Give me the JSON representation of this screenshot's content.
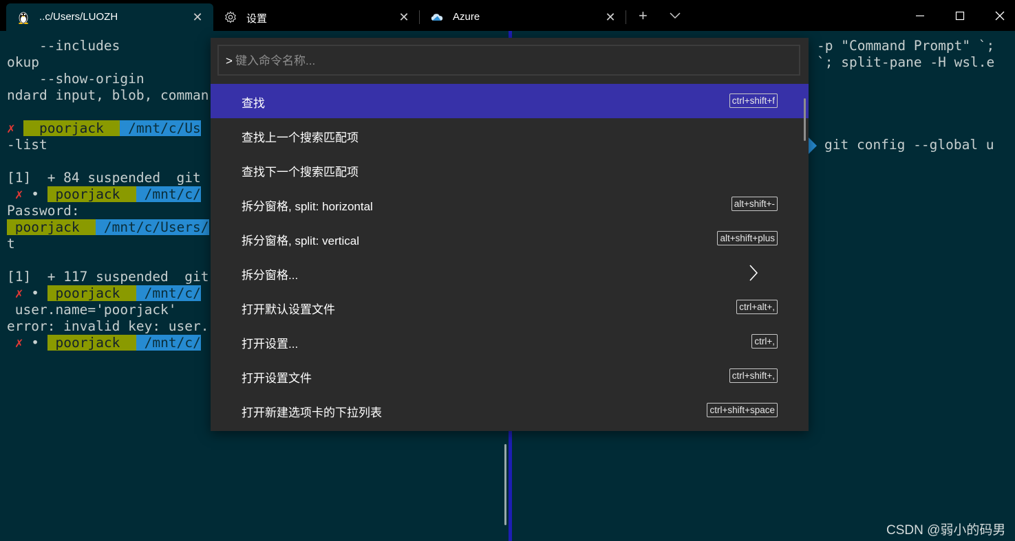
{
  "tabs": [
    {
      "title": "..c/Users/LUOZH",
      "icon": "linux-penguin-icon"
    },
    {
      "title": "设置",
      "icon": "gear-icon"
    },
    {
      "title": "Azure",
      "icon": "azure-cloud-icon"
    }
  ],
  "terminal_left": [
    "    --includes",
    "okup",
    "    --show-origin",
    "ndard input, blob, comman"
  ],
  "prompts": {
    "x_mark": "✗",
    "dot": "•",
    "user": "poorjack",
    "path1": "/mnt/c/Us",
    "path2": "/mnt/c/",
    "path3": "/mnt/c/Users/",
    "list": "-list",
    "job1": "[1]  + 84 suspended  git",
    "password": "Password:",
    "t": "t",
    "job2": "[1]  + 117 suspended  git",
    "username_line": " user.name='poorjack'",
    "error": "error: invalid key: user."
  },
  "terminal_right": [
    "-p \"Command Prompt\" `;",
    "`; split-pane -H wsl.e",
    "git config --global u"
  ],
  "palette": {
    "prefix": ">",
    "placeholder": "键入命令名称...",
    "commands": [
      {
        "label": "查找",
        "keys": "ctrl+shift+f",
        "selected": true
      },
      {
        "label": "查找上一个搜索匹配项",
        "keys": ""
      },
      {
        "label": "查找下一个搜索匹配项",
        "keys": ""
      },
      {
        "label": "拆分窗格, split: horizontal",
        "keys": "alt+shift+-"
      },
      {
        "label": "拆分窗格, split: vertical",
        "keys": "alt+shift+plus"
      },
      {
        "label": "拆分窗格...",
        "keys": "",
        "submenu": true
      },
      {
        "label": "打开默认设置文件",
        "keys": "ctrl+alt+,"
      },
      {
        "label": "打开设置...",
        "keys": "ctrl+,"
      },
      {
        "label": "打开设置文件",
        "keys": "ctrl+shift+,"
      },
      {
        "label": "打开新建选项卡的下拉列表",
        "keys": "ctrl+shift+space"
      }
    ]
  },
  "watermark": "CSDN @弱小的码男",
  "colors": {
    "accent": "#3731a8",
    "terminal_bg": "#012b36",
    "prompt_green": "#8a9a00",
    "prompt_blue": "#268bd2"
  }
}
